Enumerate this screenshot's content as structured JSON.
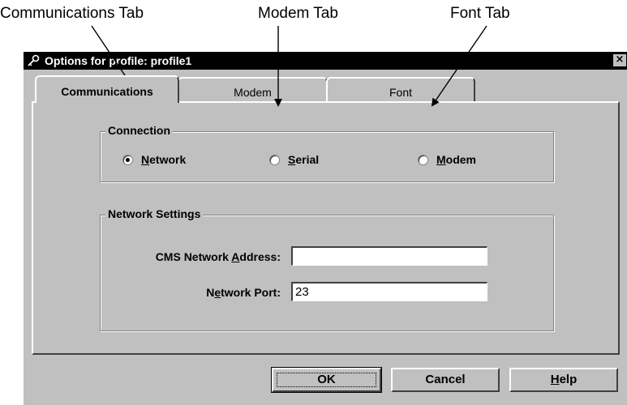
{
  "callouts": {
    "communications": "Communications Tab",
    "modem": "Modem Tab",
    "font": "Font Tab"
  },
  "window": {
    "title": "Options for profile: profile1",
    "close_glyph": "×",
    "title_icon": "key-icon"
  },
  "tabs": [
    {
      "label": "Communications",
      "active": true
    },
    {
      "label": "Modem",
      "active": false
    },
    {
      "label": "Font",
      "active": false
    }
  ],
  "connection": {
    "title": "Connection",
    "options": [
      {
        "prefix": "",
        "mnemonic": "N",
        "rest": "etwork",
        "selected": true
      },
      {
        "prefix": "",
        "mnemonic": "S",
        "rest": "erial",
        "selected": false
      },
      {
        "prefix": "",
        "mnemonic": "M",
        "rest": "odem",
        "selected": false
      }
    ]
  },
  "network_settings": {
    "title": "Network Settings",
    "address": {
      "label_pre": "CMS Network ",
      "label_mnemonic": "A",
      "label_post": "ddress:",
      "value": ""
    },
    "port": {
      "label_pre": "N",
      "label_mnemonic": "e",
      "label_post": "twork Port:",
      "value": "23"
    }
  },
  "buttons": {
    "ok": "OK",
    "cancel": "Cancel",
    "help_mnemonic": "H",
    "help_rest": "elp"
  },
  "colors": {
    "dialog_face": "#c0c0c0",
    "titlebar": "#000000"
  }
}
